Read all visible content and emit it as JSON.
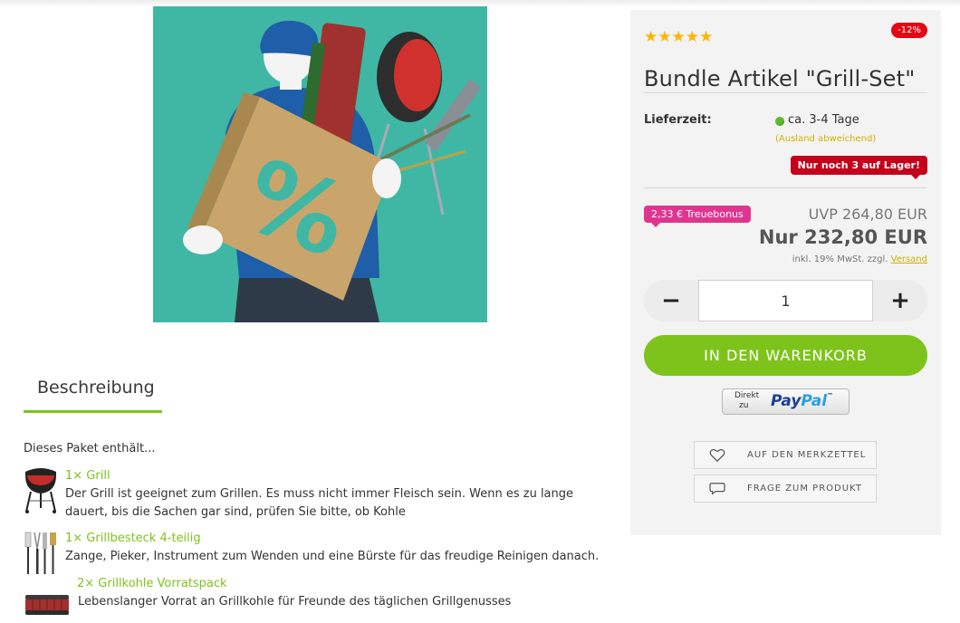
{
  "rating": {
    "stars": 5
  },
  "badges": {
    "discount": "-12%",
    "stock": "Nur noch 3 auf Lager!",
    "bonus": "2,33 € Treuebonus"
  },
  "product": {
    "title": "Bundle Artikel \"Grill-Set\""
  },
  "delivery": {
    "label": "Lieferzeit:",
    "value": "ca. 3-4 Tage",
    "note": "(Ausland abweichend)",
    "status_color": "#5dbb2c"
  },
  "pricing": {
    "uvp": "UVP 264,80 EUR",
    "price": "Nur 232,80 EUR",
    "tax_prefix": "inkl. 19% MwSt. zzgl.",
    "shipping_link": "Versand"
  },
  "quantity": {
    "value": "1",
    "minus": "−",
    "plus": "+"
  },
  "actions": {
    "cart": "IN DEN WARENKORB",
    "paypal_direct_1": "Direkt",
    "paypal_direct_2": "zu",
    "paypal_pay": "Pay",
    "paypal_pal": "Pal",
    "paypal_tm": "™",
    "wishlist": "AUF DEN MERKZETTEL",
    "question": "FRAGE ZUM PRODUKT"
  },
  "tabs": {
    "description": "Beschreibung"
  },
  "description": {
    "intro": "Dieses Paket enthält...",
    "items": [
      {
        "title": "1× Grill",
        "text": "Der Grill ist geeignet zum Grillen. Es muss nicht immer Fleisch sein. Wenn es zu lange dauert, bis die Sachen gar sind, prüfen Sie bitte, ob Kohle",
        "icon": "kettle-grill-icon"
      },
      {
        "title": "1× Grillbesteck 4-teilig",
        "text": "Zange, Pieker, Instrument zum Wenden und eine Bürste für das freudige Reinigen danach.",
        "icon": "grill-tools-icon"
      },
      {
        "title": "2× Grillkohle Vorratspack",
        "text": "Lebenslanger Vorrat an Grillkohle für Freunde des täglichen Grillgenusses",
        "icon": "charcoal-pack-icon"
      }
    ]
  },
  "colors": {
    "accent": "#7ec31c",
    "discount": "#e30613",
    "stock": "#c4001a",
    "bonus": "#e0358f",
    "link": "#d2b000",
    "image_bg": "#3fb7a4"
  }
}
